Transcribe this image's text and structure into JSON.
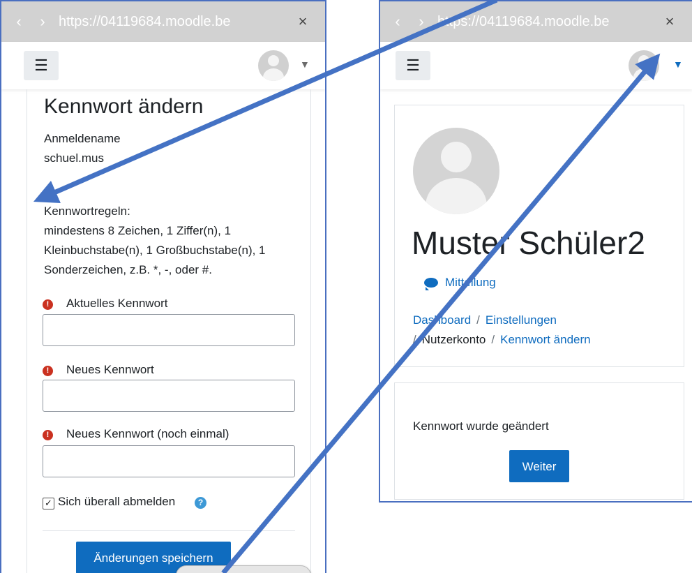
{
  "left": {
    "browser": {
      "url": "https://04119684.moodle.be",
      "back": "‹",
      "forward": "›",
      "close": "×"
    },
    "page_title": "Kennwort ändern",
    "username_label": "Anmeldename",
    "username_value": "schuel.mus",
    "rules": {
      "heading": "Kennwortregeln:",
      "line1": "mindestens 8 Zeichen, 1 Ziffer(n), 1",
      "line2": "Kleinbuchstabe(n), 1 Großbuchstabe(n), 1",
      "line3": "Sonderzeichen, z.B. *, -, oder #."
    },
    "fields": {
      "current_label": "Aktuelles Kennwort",
      "new_label": "Neues Kennwort",
      "repeat_label": "Neues Kennwort (noch einmal)",
      "required_mark": "!"
    },
    "logout_label": "Sich überall abmelden",
    "logout_checked": true,
    "save_label": "Änderungen speichern"
  },
  "right": {
    "browser": {
      "url": "https://04119684.moodle.be",
      "back": "‹",
      "forward": "›",
      "close": "×"
    },
    "user_name": "Muster Schüler2",
    "message_label": "Mitteilung",
    "breadcrumbs": {
      "dashboard": "Dashboard",
      "settings": "Einstellungen",
      "account": "Nutzerkonto",
      "change_pw": "Kennwort ändern",
      "sep": "/"
    },
    "success_message": "Kennwort wurde geändert",
    "continue_label": "Weiter"
  },
  "colors": {
    "primary": "#0f6cbf",
    "required": "#ca3120",
    "arrow": "#4472c4",
    "url_bar": "#d2d2d2"
  },
  "icons": {
    "menu": "☰",
    "caret": "▼",
    "help": "?",
    "check": "✓"
  }
}
